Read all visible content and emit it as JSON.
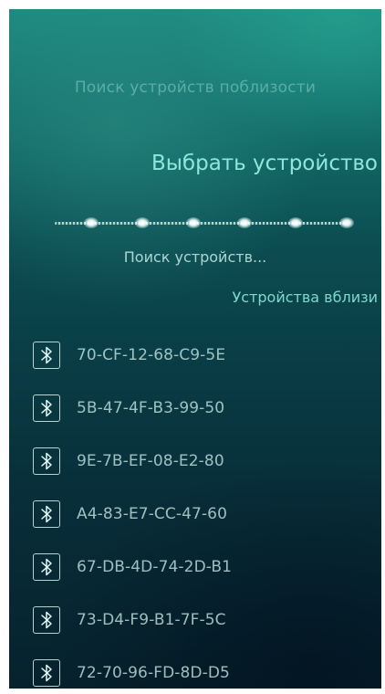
{
  "header": {
    "pulley_hint": "Поиск устройств поблизости",
    "title": "Выбрать устройство"
  },
  "search": {
    "status": "Поиск устройств..."
  },
  "section": {
    "label": "Устройства вблизи"
  },
  "devices": [
    {
      "name": "70-CF-12-68-C9-5E",
      "icon": "bluetooth-icon"
    },
    {
      "name": "5B-47-4F-B3-99-50",
      "icon": "bluetooth-icon"
    },
    {
      "name": "9E-7B-EF-08-E2-80",
      "icon": "bluetooth-icon"
    },
    {
      "name": "A4-83-E7-CC-47-60",
      "icon": "bluetooth-icon"
    },
    {
      "name": "67-DB-4D-74-2D-B1",
      "icon": "bluetooth-icon"
    },
    {
      "name": "73-D4-F9-B1-7F-5C",
      "icon": "bluetooth-icon"
    },
    {
      "name": "72-70-96-FD-8D-D5",
      "icon": "bluetooth-icon"
    }
  ],
  "colors": {
    "accent": "#8fe6dd",
    "background_top": "#1f8a80",
    "background_bottom": "#06222d"
  }
}
